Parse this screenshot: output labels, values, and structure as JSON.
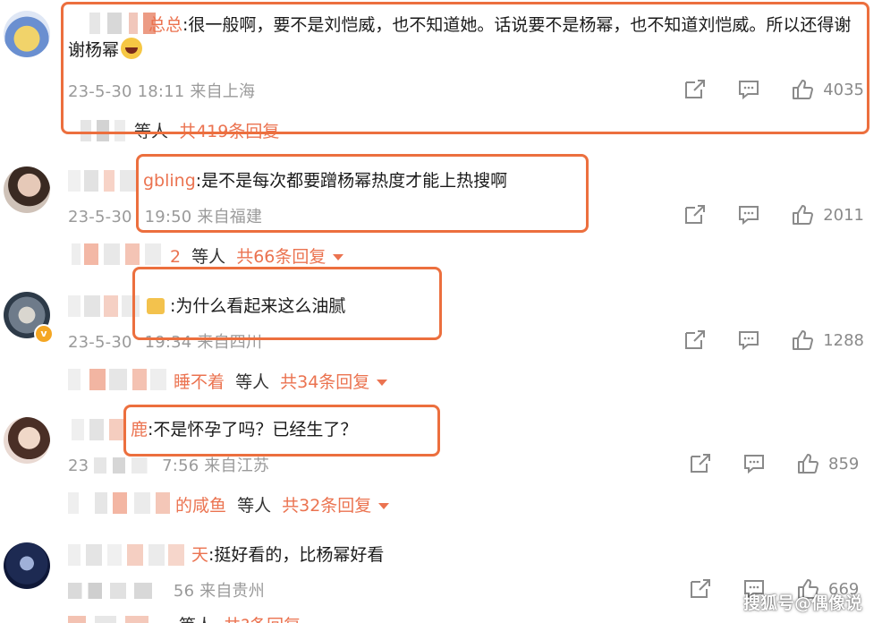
{
  "comments": [
    {
      "name_suffix": "总总",
      "text": ":很一般啊，要不是刘恺威，也不知道她。话说要不是杨幂，也不知道刘恺威。所以还得谢谢杨幂",
      "emoji": "grinning-face",
      "meta": "23-5-30 18:11 来自上海",
      "likes": "4035",
      "replies_suffix": "等人",
      "replies_count": "共419条回复"
    },
    {
      "name_suffix": "gbling",
      "text": ":是不是每次都要蹭杨幂热度才能上热搜啊",
      "meta_prefix": "23-5-30",
      "meta": "19:50 来自福建",
      "likes": "2011",
      "replies_name": "2",
      "replies_suffix": "等人",
      "replies_count": "共66条回复"
    },
    {
      "name_suffix": "",
      "text": ":为什么看起来这么油腻",
      "meta_prefix": "23-5-30",
      "meta": "19:34 来自四川",
      "likes": "1288",
      "replies_name": "睡不着",
      "replies_suffix": "等人",
      "replies_count": "共34条回复"
    },
    {
      "name_suffix": "鹿",
      "text": ":不是怀孕了吗？已经生了？",
      "meta_prefix": "23",
      "meta": "7:56 来自江苏",
      "likes": "859",
      "replies_name": "的咸鱼",
      "replies_suffix": "等人",
      "replies_count": "共32条回复"
    },
    {
      "name_suffix": "天",
      "text": ":挺好看的，比杨幂好看",
      "meta": "56 来自贵州",
      "likes": "669",
      "replies_suffix": "等人",
      "replies_count": "共?条回复"
    }
  ],
  "watermark": "搜狐号@偶像说",
  "colors": {
    "accent": "#eb7350",
    "highlight": "#ec6f3e",
    "meta": "#9a9a9a"
  }
}
